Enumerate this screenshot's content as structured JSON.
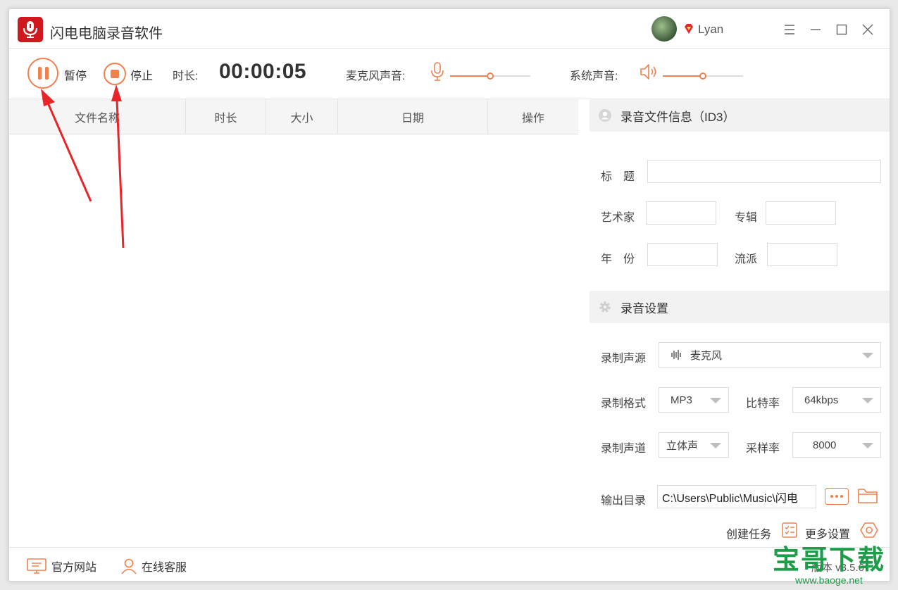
{
  "app": {
    "title": "闪电电脑录音软件",
    "user_name": "Lyan"
  },
  "toolbar": {
    "pause_label": "暂停",
    "stop_label": "停止",
    "duration_label": "时长:",
    "duration_value": "00:00:05",
    "mic_label": "麦克风声音:",
    "mic_level": 0.5,
    "system_label": "系统声音:",
    "system_level": 0.5
  },
  "table": {
    "columns": [
      "文件名称",
      "时长",
      "大小",
      "日期",
      "操作"
    ],
    "rows": []
  },
  "id3": {
    "header": "录音文件信息（ID3）",
    "title_label": "标　题",
    "artist_label": "艺术家",
    "album_label": "专辑",
    "year_label": "年　份",
    "genre_label": "流派",
    "title_value": "",
    "artist_value": "",
    "album_value": "",
    "year_value": "",
    "genre_value": ""
  },
  "settings": {
    "header": "录音设置",
    "source_label": "录制声源",
    "source_value": "麦克风",
    "format_label": "录制格式",
    "format_value": "MP3",
    "bitrate_label": "比特率",
    "bitrate_value": "64kbps",
    "channel_label": "录制声道",
    "channel_value": "立体声",
    "samplerate_label": "采样率",
    "samplerate_value": "8000",
    "output_label": "输出目录",
    "output_value": "C:\\Users\\Public\\Music\\闪电",
    "create_task_label": "创建任务",
    "more_settings_label": "更多设置"
  },
  "footer": {
    "website_label": "官方网站",
    "support_label": "在线客服",
    "version": "版本 v3.5.6"
  },
  "watermark": {
    "main": "宝哥下载",
    "sub": "www.baoge.net"
  },
  "colors": {
    "accent": "#f0804e",
    "brand_red": "#d0191f",
    "annotation_arrow": "#e8262a",
    "watermark_green": "#1d9c4a"
  }
}
